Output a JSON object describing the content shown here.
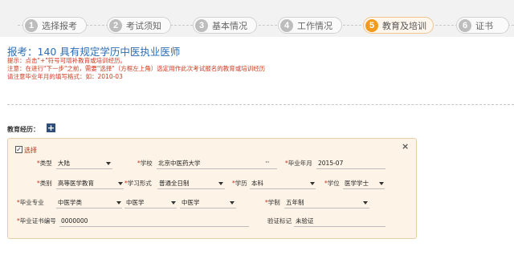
{
  "steps": [
    {
      "num": "1",
      "label": "选择报考"
    },
    {
      "num": "2",
      "label": "考试须知"
    },
    {
      "num": "3",
      "label": "基本情况"
    },
    {
      "num": "4",
      "label": "工作情况"
    },
    {
      "num": "5",
      "label": "教育及培训"
    },
    {
      "num": "6",
      "label": "证书"
    }
  ],
  "active_step": "5",
  "colors": {
    "accent": "#f29b1c",
    "title_blue": "#2c6eb3",
    "note_red": "#cc3a1e",
    "panel_bg": "#fdf3e6"
  },
  "header": {
    "title": "报考：140 具有规定学历中医执业医师"
  },
  "notes": [
    "提示：点击\"+\"符号可增补教育或培训经历。",
    "注意：在进行\"下一步\"之前，需要\"选择\"（方框左上角）选定用作此次考试报名的教育或培训经历",
    "请注意毕业年月的填写格式：如：2010-03"
  ],
  "education": {
    "section_label": "教育经历：",
    "add_icon": "plus-icon",
    "close_icon": "close-icon",
    "select_label": "选择",
    "select_checked": true,
    "fields": {
      "type": {
        "label": "类型",
        "value": "大陆"
      },
      "school": {
        "label": "学校",
        "value": "北京中医药大学",
        "more": "···"
      },
      "grad_date": {
        "label": "毕业年月",
        "value": "2015-07"
      },
      "category": {
        "label": "类别",
        "value": "高等医学教育"
      },
      "study_form": {
        "label": "学习形式",
        "value": "普通全日制"
      },
      "degree_level": {
        "label": "学历",
        "value": "本科"
      },
      "academic_degree": {
        "label": "学位",
        "value": "医学学士"
      },
      "major": {
        "label": "毕业专业",
        "value1": "中医学类",
        "value2": "中医学",
        "value3": "中医学"
      },
      "duration": {
        "label": "学制",
        "value": "五年制"
      },
      "cert_no": {
        "label": "毕业证书编号",
        "value": "0000000"
      },
      "verify": {
        "label": "验证标记",
        "value": "未验证"
      }
    }
  }
}
